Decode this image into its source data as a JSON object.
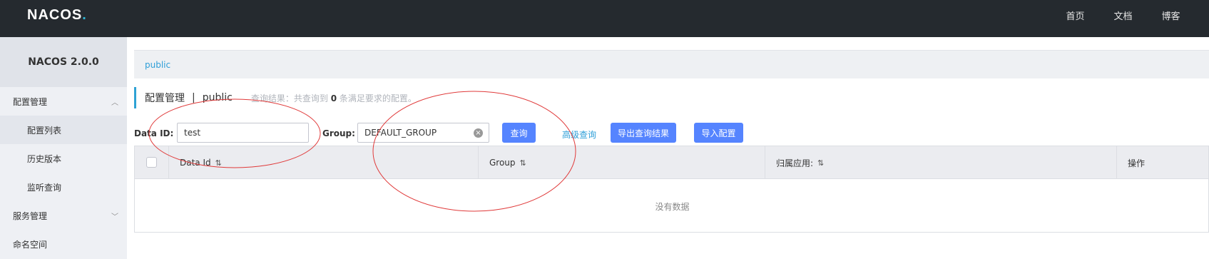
{
  "header": {
    "logo": "NACOS",
    "nav": [
      "首页",
      "文档",
      "博客"
    ]
  },
  "sidebar": {
    "title": "NACOS 2.0.0",
    "groups": [
      {
        "label": "配置管理",
        "items": [
          "配置列表",
          "历史版本",
          "监听查询"
        ]
      },
      {
        "label": "服务管理"
      },
      {
        "label": "命名空间"
      }
    ]
  },
  "namespace_bar": {
    "label": "public"
  },
  "page": {
    "title": "配置管理",
    "separator": "|",
    "namespace": "public",
    "result_prefix": "查询结果：共查询到",
    "result_count": "0",
    "result_suffix": "条满足要求的配置。"
  },
  "filter": {
    "data_id_label": "Data ID:",
    "data_id_value": "test",
    "group_label": "Group:",
    "group_value": "DEFAULT_GROUP",
    "search_button": "查询",
    "advanced_link": "高级查询",
    "export_button": "导出查询结果",
    "import_button": "导入配置"
  },
  "table": {
    "columns": [
      "Data Id",
      "Group",
      "归属应用:",
      "操作"
    ],
    "empty_text": "没有数据"
  },
  "colors": {
    "topbar": "#252a2f",
    "primary_button": "#5584ff",
    "link": "#2f9fd8",
    "annotation": "#e03a3a"
  }
}
